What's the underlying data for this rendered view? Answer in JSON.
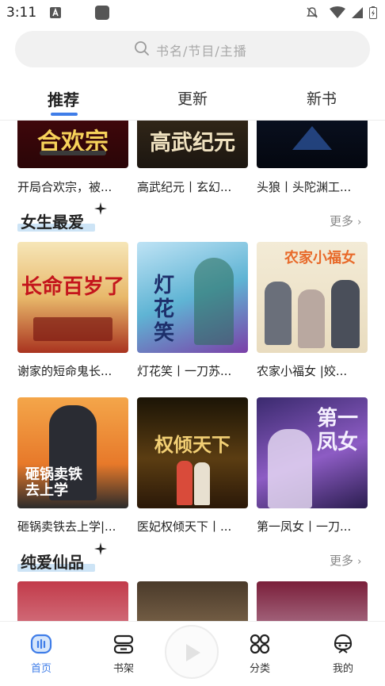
{
  "status_bar": {
    "time": "3:11"
  },
  "search": {
    "placeholder": "书名/节目/主播"
  },
  "tabs": [
    {
      "label": "推荐",
      "active": true
    },
    {
      "label": "更新",
      "active": false
    },
    {
      "label": "新书",
      "active": false
    }
  ],
  "top_row": [
    {
      "title": "开局合欢宗，被...",
      "cover_text": "合欢宗"
    },
    {
      "title": "高武纪元丨玄幻...",
      "cover_text": "高武纪元"
    },
    {
      "title": "头狼丨头陀渊工...",
      "cover_text": ""
    }
  ],
  "sections": [
    {
      "title": "女生最爱",
      "more": "更多",
      "books": [
        {
          "title": "谢家的短命鬼长...",
          "cover_text": "长命百岁了"
        },
        {
          "title": "灯花笑丨一刀苏...",
          "cover_text": "灯花笑"
        },
        {
          "title": "农家小福女 |姣...",
          "cover_text": "农家小福女"
        },
        {
          "title": "砸锅卖铁去上学|...",
          "cover_text": "砸锅卖铁去上学"
        },
        {
          "title": "医妃权倾天下丨...",
          "cover_text": "权倾天下"
        },
        {
          "title": "第一凤女丨一刀...",
          "cover_text": "第一凤女"
        }
      ]
    },
    {
      "title": "纯爱仙品",
      "more": "更多",
      "books": []
    }
  ],
  "bottom_nav": [
    {
      "label": "首页",
      "icon": "home-icon",
      "active": true
    },
    {
      "label": "书架",
      "icon": "bookshelf-icon",
      "active": false
    },
    {
      "label": "分类",
      "icon": "category-icon",
      "active": false
    },
    {
      "label": "我的",
      "icon": "profile-icon",
      "active": false
    }
  ],
  "colors": {
    "accent": "#3f7de8",
    "highlight": "#cde4f6"
  }
}
